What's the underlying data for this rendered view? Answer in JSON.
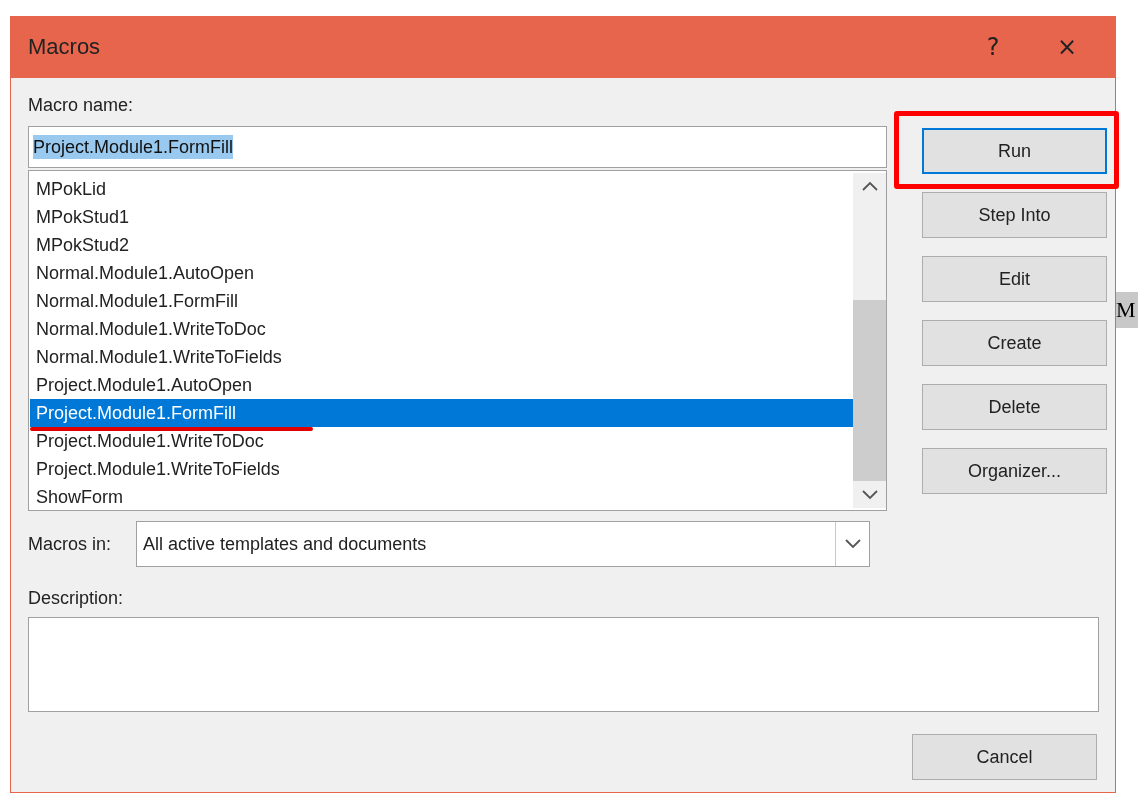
{
  "background": {
    "side_text": "M"
  },
  "window": {
    "title": "Macros",
    "help": "?",
    "close": "×"
  },
  "macro_name": {
    "label": "Macro name:",
    "value": "Project.Module1.FormFill"
  },
  "macros": [
    {
      "name": "MPokLid",
      "selected": false
    },
    {
      "name": "MPokStud1",
      "selected": false
    },
    {
      "name": "MPokStud2",
      "selected": false
    },
    {
      "name": "Normal.Module1.AutoOpen",
      "selected": false
    },
    {
      "name": "Normal.Module1.FormFill",
      "selected": false
    },
    {
      "name": "Normal.Module1.WriteToDoc",
      "selected": false
    },
    {
      "name": "Normal.Module1.WriteToFields",
      "selected": false
    },
    {
      "name": "Project.Module1.AutoOpen",
      "selected": false
    },
    {
      "name": "Project.Module1.FormFill",
      "selected": true
    },
    {
      "name": "Project.Module1.WriteToDoc",
      "selected": false
    },
    {
      "name": "Project.Module1.WriteToFields",
      "selected": false
    },
    {
      "name": "ShowForm",
      "selected": false
    }
  ],
  "macros_in": {
    "label": "Macros in:",
    "value": "All active templates and documents"
  },
  "description": {
    "label": "Description:"
  },
  "buttons": [
    {
      "label": "Run",
      "focused": true,
      "highlighted": true
    },
    {
      "label": "Step Into",
      "focused": false,
      "highlighted": false
    },
    {
      "label": "Edit",
      "focused": false,
      "highlighted": false
    },
    {
      "label": "Create",
      "focused": false,
      "highlighted": false
    },
    {
      "label": "Delete",
      "focused": false,
      "highlighted": false
    },
    {
      "label": "Organizer...",
      "focused": false,
      "highlighted": false
    }
  ],
  "cancel": {
    "label": "Cancel"
  }
}
